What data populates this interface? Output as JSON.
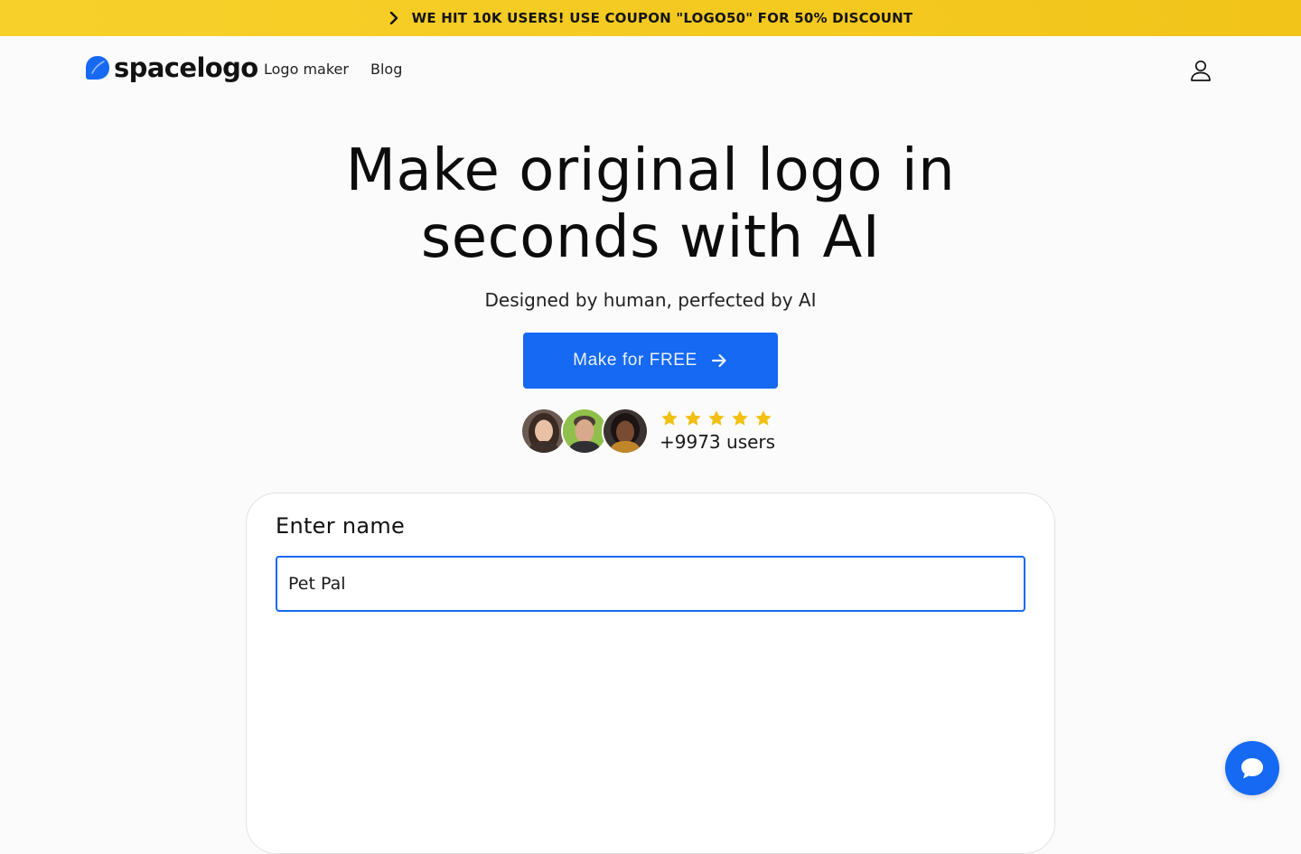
{
  "promo": {
    "text": "WE HIT 10K USERS! USE COUPON \"LOGO50\" FOR 50% DISCOUNT"
  },
  "nav": {
    "brand": "spacelogo",
    "links": [
      {
        "label": "Logo maker"
      },
      {
        "label": "Blog"
      }
    ]
  },
  "hero": {
    "title": "Make original logo in seconds with AI",
    "subtitle": "Designed by human, perfected by AI",
    "cta_label": "Make for FREE",
    "rating_stars": 5,
    "users_count": "+9973 users"
  },
  "form": {
    "label": "Enter name",
    "name_value": "Pet Pal"
  },
  "colors": {
    "accent": "#1569f3",
    "promo_bg": "#f4c81f",
    "star": "#f2c014"
  },
  "icons": {
    "promo": "chevron-right-icon",
    "brand": "leaf-logo-icon",
    "account": "user-icon",
    "cta": "arrow-right-icon",
    "rating": "star-icon",
    "chat": "chat-bubble-icon"
  }
}
